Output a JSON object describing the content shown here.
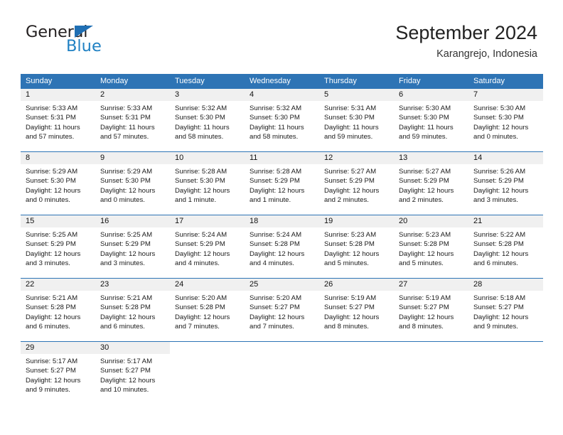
{
  "brand": {
    "name_part1": "General",
    "name_part2": "Blue",
    "triangle_color": "#1f6fb4",
    "blue_color": "#2081c3"
  },
  "header": {
    "title": "September 2024",
    "subtitle": "Karangrejo, Indonesia"
  },
  "theme": {
    "header_blue": "#2e74b5",
    "date_strip_gray": "#f0f0f0",
    "text_color": "#1a1a1a"
  },
  "weekdays": [
    "Sunday",
    "Monday",
    "Tuesday",
    "Wednesday",
    "Thursday",
    "Friday",
    "Saturday"
  ],
  "weeks": [
    [
      {
        "day": "1",
        "sunrise": "Sunrise: 5:33 AM",
        "sunset": "Sunset: 5:31 PM",
        "daylight1": "Daylight: 11 hours",
        "daylight2": "and 57 minutes."
      },
      {
        "day": "2",
        "sunrise": "Sunrise: 5:33 AM",
        "sunset": "Sunset: 5:31 PM",
        "daylight1": "Daylight: 11 hours",
        "daylight2": "and 57 minutes."
      },
      {
        "day": "3",
        "sunrise": "Sunrise: 5:32 AM",
        "sunset": "Sunset: 5:30 PM",
        "daylight1": "Daylight: 11 hours",
        "daylight2": "and 58 minutes."
      },
      {
        "day": "4",
        "sunrise": "Sunrise: 5:32 AM",
        "sunset": "Sunset: 5:30 PM",
        "daylight1": "Daylight: 11 hours",
        "daylight2": "and 58 minutes."
      },
      {
        "day": "5",
        "sunrise": "Sunrise: 5:31 AM",
        "sunset": "Sunset: 5:30 PM",
        "daylight1": "Daylight: 11 hours",
        "daylight2": "and 59 minutes."
      },
      {
        "day": "6",
        "sunrise": "Sunrise: 5:30 AM",
        "sunset": "Sunset: 5:30 PM",
        "daylight1": "Daylight: 11 hours",
        "daylight2": "and 59 minutes."
      },
      {
        "day": "7",
        "sunrise": "Sunrise: 5:30 AM",
        "sunset": "Sunset: 5:30 PM",
        "daylight1": "Daylight: 12 hours",
        "daylight2": "and 0 minutes."
      }
    ],
    [
      {
        "day": "8",
        "sunrise": "Sunrise: 5:29 AM",
        "sunset": "Sunset: 5:30 PM",
        "daylight1": "Daylight: 12 hours",
        "daylight2": "and 0 minutes."
      },
      {
        "day": "9",
        "sunrise": "Sunrise: 5:29 AM",
        "sunset": "Sunset: 5:30 PM",
        "daylight1": "Daylight: 12 hours",
        "daylight2": "and 0 minutes."
      },
      {
        "day": "10",
        "sunrise": "Sunrise: 5:28 AM",
        "sunset": "Sunset: 5:30 PM",
        "daylight1": "Daylight: 12 hours",
        "daylight2": "and 1 minute."
      },
      {
        "day": "11",
        "sunrise": "Sunrise: 5:28 AM",
        "sunset": "Sunset: 5:29 PM",
        "daylight1": "Daylight: 12 hours",
        "daylight2": "and 1 minute."
      },
      {
        "day": "12",
        "sunrise": "Sunrise: 5:27 AM",
        "sunset": "Sunset: 5:29 PM",
        "daylight1": "Daylight: 12 hours",
        "daylight2": "and 2 minutes."
      },
      {
        "day": "13",
        "sunrise": "Sunrise: 5:27 AM",
        "sunset": "Sunset: 5:29 PM",
        "daylight1": "Daylight: 12 hours",
        "daylight2": "and 2 minutes."
      },
      {
        "day": "14",
        "sunrise": "Sunrise: 5:26 AM",
        "sunset": "Sunset: 5:29 PM",
        "daylight1": "Daylight: 12 hours",
        "daylight2": "and 3 minutes."
      }
    ],
    [
      {
        "day": "15",
        "sunrise": "Sunrise: 5:25 AM",
        "sunset": "Sunset: 5:29 PM",
        "daylight1": "Daylight: 12 hours",
        "daylight2": "and 3 minutes."
      },
      {
        "day": "16",
        "sunrise": "Sunrise: 5:25 AM",
        "sunset": "Sunset: 5:29 PM",
        "daylight1": "Daylight: 12 hours",
        "daylight2": "and 3 minutes."
      },
      {
        "day": "17",
        "sunrise": "Sunrise: 5:24 AM",
        "sunset": "Sunset: 5:29 PM",
        "daylight1": "Daylight: 12 hours",
        "daylight2": "and 4 minutes."
      },
      {
        "day": "18",
        "sunrise": "Sunrise: 5:24 AM",
        "sunset": "Sunset: 5:28 PM",
        "daylight1": "Daylight: 12 hours",
        "daylight2": "and 4 minutes."
      },
      {
        "day": "19",
        "sunrise": "Sunrise: 5:23 AM",
        "sunset": "Sunset: 5:28 PM",
        "daylight1": "Daylight: 12 hours",
        "daylight2": "and 5 minutes."
      },
      {
        "day": "20",
        "sunrise": "Sunrise: 5:23 AM",
        "sunset": "Sunset: 5:28 PM",
        "daylight1": "Daylight: 12 hours",
        "daylight2": "and 5 minutes."
      },
      {
        "day": "21",
        "sunrise": "Sunrise: 5:22 AM",
        "sunset": "Sunset: 5:28 PM",
        "daylight1": "Daylight: 12 hours",
        "daylight2": "and 6 minutes."
      }
    ],
    [
      {
        "day": "22",
        "sunrise": "Sunrise: 5:21 AM",
        "sunset": "Sunset: 5:28 PM",
        "daylight1": "Daylight: 12 hours",
        "daylight2": "and 6 minutes."
      },
      {
        "day": "23",
        "sunrise": "Sunrise: 5:21 AM",
        "sunset": "Sunset: 5:28 PM",
        "daylight1": "Daylight: 12 hours",
        "daylight2": "and 6 minutes."
      },
      {
        "day": "24",
        "sunrise": "Sunrise: 5:20 AM",
        "sunset": "Sunset: 5:28 PM",
        "daylight1": "Daylight: 12 hours",
        "daylight2": "and 7 minutes."
      },
      {
        "day": "25",
        "sunrise": "Sunrise: 5:20 AM",
        "sunset": "Sunset: 5:27 PM",
        "daylight1": "Daylight: 12 hours",
        "daylight2": "and 7 minutes."
      },
      {
        "day": "26",
        "sunrise": "Sunrise: 5:19 AM",
        "sunset": "Sunset: 5:27 PM",
        "daylight1": "Daylight: 12 hours",
        "daylight2": "and 8 minutes."
      },
      {
        "day": "27",
        "sunrise": "Sunrise: 5:19 AM",
        "sunset": "Sunset: 5:27 PM",
        "daylight1": "Daylight: 12 hours",
        "daylight2": "and 8 minutes."
      },
      {
        "day": "28",
        "sunrise": "Sunrise: 5:18 AM",
        "sunset": "Sunset: 5:27 PM",
        "daylight1": "Daylight: 12 hours",
        "daylight2": "and 9 minutes."
      }
    ],
    [
      {
        "day": "29",
        "sunrise": "Sunrise: 5:17 AM",
        "sunset": "Sunset: 5:27 PM",
        "daylight1": "Daylight: 12 hours",
        "daylight2": "and 9 minutes."
      },
      {
        "day": "30",
        "sunrise": "Sunrise: 5:17 AM",
        "sunset": "Sunset: 5:27 PM",
        "daylight1": "Daylight: 12 hours",
        "daylight2": "and 10 minutes."
      },
      {
        "day": "",
        "sunrise": "",
        "sunset": "",
        "daylight1": "",
        "daylight2": ""
      },
      {
        "day": "",
        "sunrise": "",
        "sunset": "",
        "daylight1": "",
        "daylight2": ""
      },
      {
        "day": "",
        "sunrise": "",
        "sunset": "",
        "daylight1": "",
        "daylight2": ""
      },
      {
        "day": "",
        "sunrise": "",
        "sunset": "",
        "daylight1": "",
        "daylight2": ""
      },
      {
        "day": "",
        "sunrise": "",
        "sunset": "",
        "daylight1": "",
        "daylight2": ""
      }
    ]
  ]
}
